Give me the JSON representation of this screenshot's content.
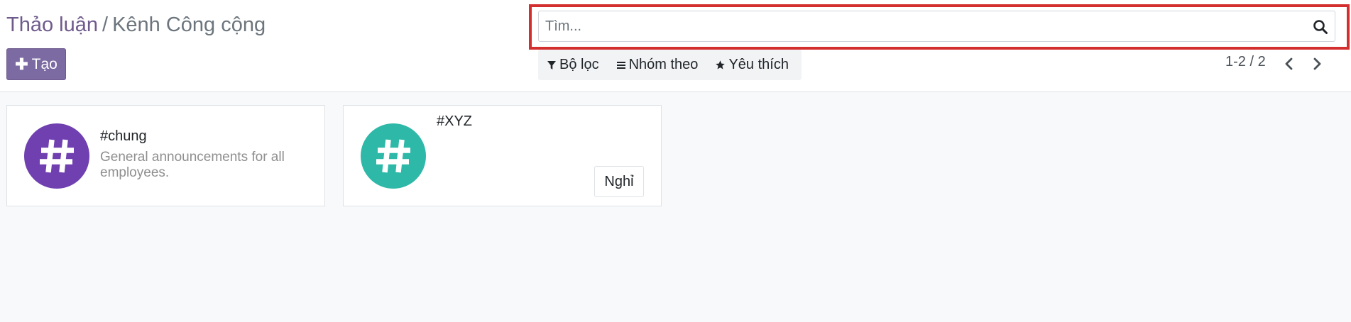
{
  "breadcrumb": {
    "parent": "Thảo luận",
    "separator": "/",
    "current": "Kênh Công cộng"
  },
  "create_button": {
    "label": "Tạo",
    "icon": "plus-icon"
  },
  "search": {
    "placeholder": "Tìm...",
    "value": "",
    "icon": "search-icon"
  },
  "filters": [
    {
      "label": "Bộ lọc",
      "icon": "filter-icon"
    },
    {
      "label": "Nhóm theo",
      "icon": "bars-icon"
    },
    {
      "label": "Yêu thích",
      "icon": "star-icon"
    }
  ],
  "pager": {
    "text": "1-2 / 2"
  },
  "channels": [
    {
      "name": "#chung",
      "description": "General announcements for all employees.",
      "avatar_color": "#7040b0",
      "avatar_icon": "hashtag-icon"
    },
    {
      "name": "#XYZ",
      "description": "",
      "avatar_color": "#2eb8a8",
      "avatar_icon": "hashtag-icon",
      "leave_label": "Nghỉ"
    }
  ],
  "colors": {
    "accent": "#7c6aa3",
    "highlight": "#d32f2f"
  }
}
